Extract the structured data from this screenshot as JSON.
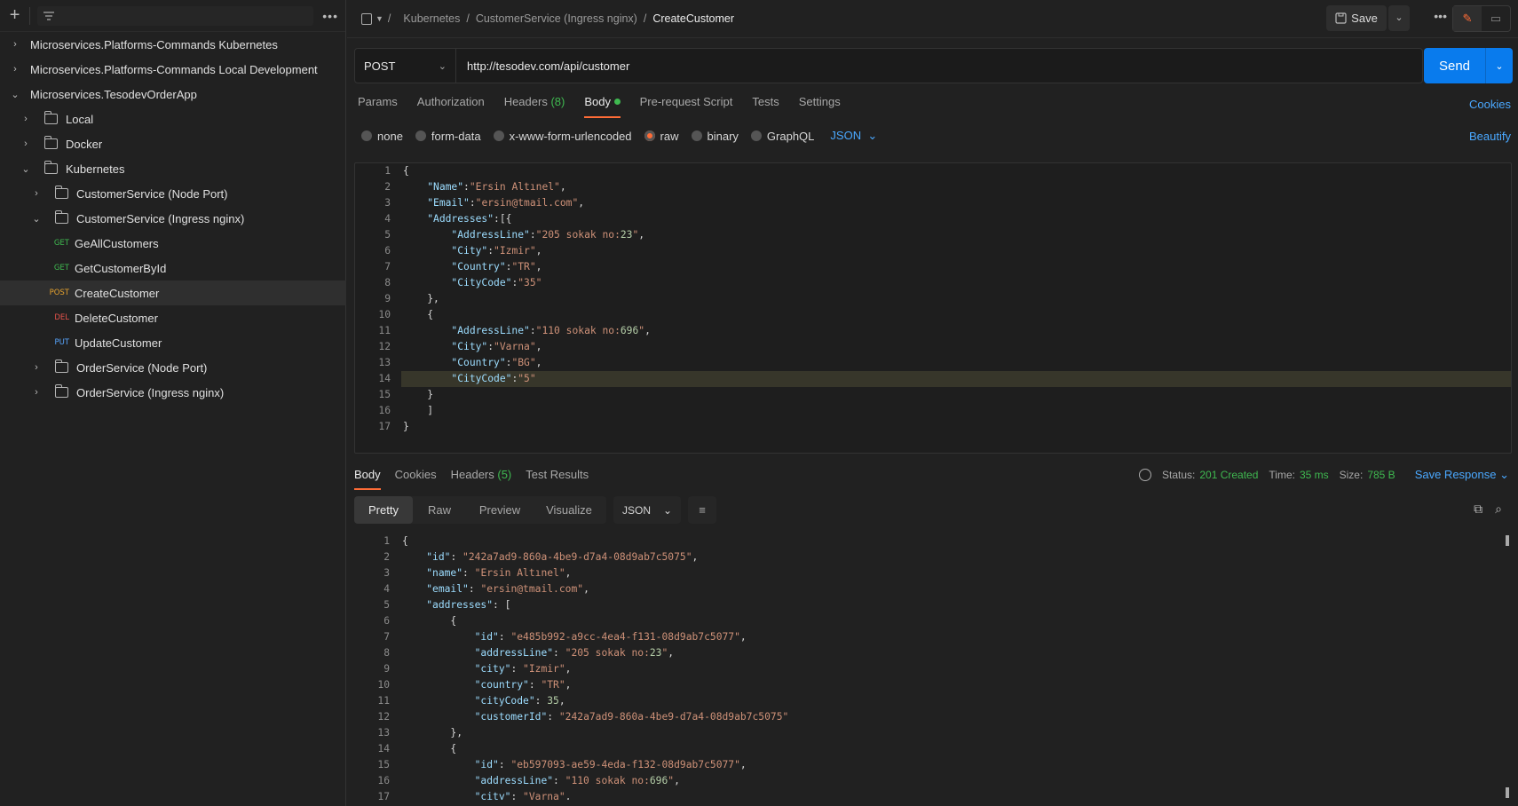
{
  "sidebar": {
    "items": [
      {
        "label": "Microservices.Platforms-Commands Kubernetes",
        "chev": "›"
      },
      {
        "label": "Microservices.Platforms-Commands Local Development",
        "chev": "›"
      },
      {
        "label": "Microservices.TesodevOrderApp",
        "chev": "⌄"
      },
      {
        "label": "Local",
        "chev": "›"
      },
      {
        "label": "Docker",
        "chev": "›"
      },
      {
        "label": "Kubernetes",
        "chev": "⌄"
      },
      {
        "label": "CustomerService (Node Port)",
        "chev": "›"
      },
      {
        "label": "CustomerService (Ingress nginx)",
        "chev": "⌄"
      },
      {
        "label": "GeAllCustomers",
        "method": "GET"
      },
      {
        "label": "GetCustomerById",
        "method": "GET"
      },
      {
        "label": "CreateCustomer",
        "method": "POST"
      },
      {
        "label": "DeleteCustomer",
        "method": "DEL"
      },
      {
        "label": "UpdateCustomer",
        "method": "PUT"
      },
      {
        "label": "OrderService (Node Port)",
        "chev": "›"
      },
      {
        "label": "OrderService (Ingress nginx)",
        "chev": "›"
      }
    ]
  },
  "breadcrumb": {
    "sep": "/",
    "parts": [
      "Kubernetes",
      "CustomerService (Ingress nginx)"
    ],
    "current": "CreateCustomer"
  },
  "toolbar": {
    "save_label": "Save"
  },
  "request": {
    "method": "POST",
    "url": "http://tesodev.com/api/customer",
    "send_label": "Send"
  },
  "request_tabs": {
    "params": "Params",
    "auth": "Authorization",
    "headers": "Headers",
    "headers_count": "(8)",
    "body": "Body",
    "prescript": "Pre-request Script",
    "tests": "Tests",
    "settings": "Settings",
    "cookies": "Cookies"
  },
  "body_options": {
    "none": "none",
    "formdata": "form-data",
    "urlencoded": "x-www-form-urlencoded",
    "raw": "raw",
    "binary": "binary",
    "graphql": "GraphQL",
    "format": "JSON",
    "beautify": "Beautify"
  },
  "request_body": [
    "{",
    "    \"Name\":\"Ersin Altınel\",",
    "    \"Email\":\"ersin@tmail.com\",",
    "    \"Addresses\":[{",
    "        \"AddressLine\":\"205 sokak no:23\",",
    "        \"City\":\"Izmir\",",
    "        \"Country\":\"TR\",",
    "        \"CityCode\":\"35\"",
    "    },",
    "    {",
    "        \"AddressLine\":\"110 sokak no:696\",",
    "        \"City\":\"Varna\",",
    "        \"Country\":\"BG\",",
    "        \"CityCode\":\"5\"",
    "    }",
    "    ]",
    "}"
  ],
  "response_tabs": {
    "body": "Body",
    "cookies": "Cookies",
    "headers": "Headers",
    "headers_count": "(5)",
    "tests": "Test Results"
  },
  "response_status": {
    "status_label": "Status:",
    "status": "201 Created",
    "time_label": "Time:",
    "time": "35 ms",
    "size_label": "Size:",
    "size": "785 B",
    "save_response": "Save Response"
  },
  "response_view": {
    "pretty": "Pretty",
    "raw": "Raw",
    "preview": "Preview",
    "visualize": "Visualize",
    "format": "JSON"
  },
  "response_body": [
    "{",
    "    \"id\": \"242a7ad9-860a-4be9-d7a4-08d9ab7c5075\",",
    "    \"name\": \"Ersin Altınel\",",
    "    \"email\": \"ersin@tmail.com\",",
    "    \"addresses\": [",
    "        {",
    "            \"id\": \"e485b992-a9cc-4ea4-f131-08d9ab7c5077\",",
    "            \"addressLine\": \"205 sokak no:23\",",
    "            \"city\": \"Izmir\",",
    "            \"country\": \"TR\",",
    "            \"cityCode\": 35,",
    "            \"customerId\": \"242a7ad9-860a-4be9-d7a4-08d9ab7c5075\"",
    "        },",
    "        {",
    "            \"id\": \"eb597093-ae59-4eda-f132-08d9ab7c5077\",",
    "            \"addressLine\": \"110 sokak no:696\",",
    "            \"city\": \"Varna\","
  ]
}
